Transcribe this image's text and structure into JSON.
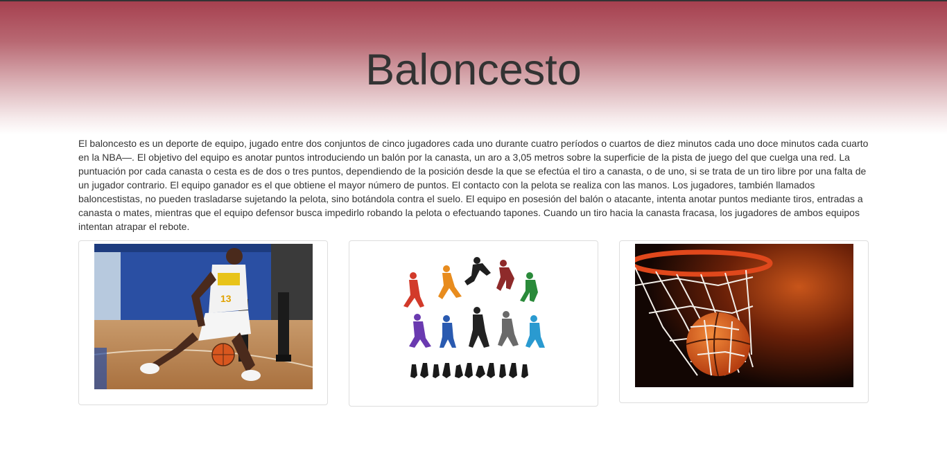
{
  "header": {
    "title": "Baloncesto"
  },
  "intro": {
    "text": "El baloncesto es un deporte de equipo, jugado entre dos conjuntos de cinco jugadores cada uno durante cuatro períodos o cuartos de diez minutos cada uno doce minutos cada cuarto en la NBA—. El objetivo del equipo es anotar puntos introduciendo un balón por la canasta, un aro a 3,05 metros sobre la superficie de la pista de juego del que cuelga una red. La puntuación por cada canasta o cesta es de dos o tres puntos, dependiendo de la posición desde la que se efectúa el tiro a canasta, o de uno, si se trata de un tiro libre por una falta de un jugador contrario. El equipo ganador es el que obtiene el mayor número de puntos. El contacto con la pelota se realiza con las manos. Los jugadores, también llamados baloncestistas, no pueden trasladarse sujetando la pelota, sino botándola contra el suelo. El equipo en posesión del balón o atacante, intenta anotar puntos mediante tiros, entradas a canasta o mates, mientras que el equipo defensor busca impedirlo robando la pelota o efectuando tapones. Cuando un tiro hacia la canasta fracasa, los jugadores de ambos equipos intentan atrapar el rebote."
  },
  "gallery": {
    "player_jersey_number": "13",
    "colors": {
      "hero_top": "#a6404f",
      "card_border": "#dddddd",
      "court_floor": "#b9855a",
      "arena_wall": "#2a4fa3",
      "rim_orange": "#e0481c",
      "ball_orange": "#d8571f"
    }
  }
}
